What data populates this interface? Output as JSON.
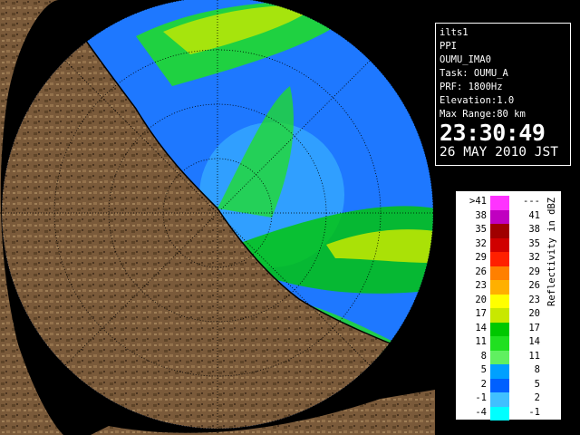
{
  "info": {
    "site": "ilts1",
    "mode": "PPI",
    "product": "OUMU_IMA0",
    "task": "Task: OUMU_A",
    "prf": "PRF: 1800Hz",
    "elevation": "Elevation:1.0",
    "max_range": "Max Range:80 km",
    "time": "23:30:49",
    "date": "26 MAY 2010 JST"
  },
  "legend": {
    "label": "Reflectivity in dBZ",
    "rows": [
      {
        "lo": ">41",
        "hi": "---",
        "color": "#ff33ff"
      },
      {
        "lo": "38",
        "hi": "41",
        "color": "#c000c0"
      },
      {
        "lo": "35",
        "hi": "38",
        "color": "#a00000"
      },
      {
        "lo": "32",
        "hi": "35",
        "color": "#d00000"
      },
      {
        "lo": "29",
        "hi": "32",
        "color": "#ff2000"
      },
      {
        "lo": "26",
        "hi": "29",
        "color": "#ff8000"
      },
      {
        "lo": "23",
        "hi": "26",
        "color": "#ffb000"
      },
      {
        "lo": "20",
        "hi": "23",
        "color": "#ffff00"
      },
      {
        "lo": "17",
        "hi": "20",
        "color": "#c8e800"
      },
      {
        "lo": "14",
        "hi": "17",
        "color": "#00c800"
      },
      {
        "lo": "11",
        "hi": "14",
        "color": "#20e020"
      },
      {
        "lo": "8",
        "hi": "11",
        "color": "#60f060"
      },
      {
        "lo": "5",
        "hi": "8",
        "color": "#00a0ff"
      },
      {
        "lo": "2",
        "hi": "5",
        "color": "#0060ff"
      },
      {
        "lo": "-1",
        "hi": "2",
        "color": "#40c0ff"
      },
      {
        "lo": "-4",
        "hi": "-1",
        "color": "#00ffff"
      }
    ]
  },
  "map_colors": {
    "background": "#000000",
    "land": "#7a5a3a",
    "clear_air": "#1e78ff",
    "rings": "#000000"
  }
}
